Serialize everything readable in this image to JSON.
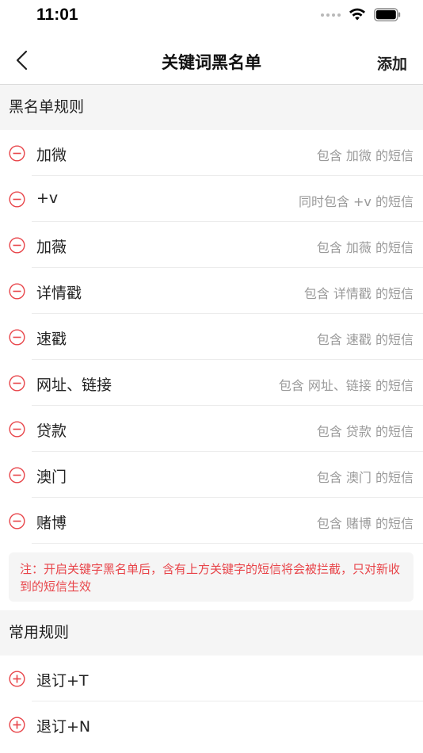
{
  "status": {
    "time": "11:01"
  },
  "nav": {
    "title": "关键词黑名单",
    "add_label": "添加"
  },
  "blacklist": {
    "header": "黑名单规则",
    "items": [
      {
        "keyword": "加微",
        "desc": "包含 加微 的短信"
      },
      {
        "keyword": "+v",
        "desc": "同时包含 +v 的短信"
      },
      {
        "keyword": "加薇",
        "desc": "包含 加薇 的短信"
      },
      {
        "keyword": "详情戳",
        "desc": "包含 详情戳 的短信"
      },
      {
        "keyword": "速戳",
        "desc": "包含 速戳 的短信"
      },
      {
        "keyword": "网址、链接",
        "desc": "包含 网址、链接 的短信"
      },
      {
        "keyword": "贷款",
        "desc": "包含 贷款 的短信"
      },
      {
        "keyword": "澳门",
        "desc": "包含 澳门 的短信"
      },
      {
        "keyword": "赌博",
        "desc": "包含 赌博 的短信"
      }
    ]
  },
  "note": "注：开启关键字黑名单后，含有上方关键字的短信将会被拦截，只对新收到的短信生效",
  "common": {
    "header": "常用规则",
    "items": [
      {
        "keyword": "退订+T"
      },
      {
        "keyword": "退订+N"
      }
    ]
  },
  "colors": {
    "accent": "#e8454a",
    "section_bg": "#f5f5f5"
  }
}
